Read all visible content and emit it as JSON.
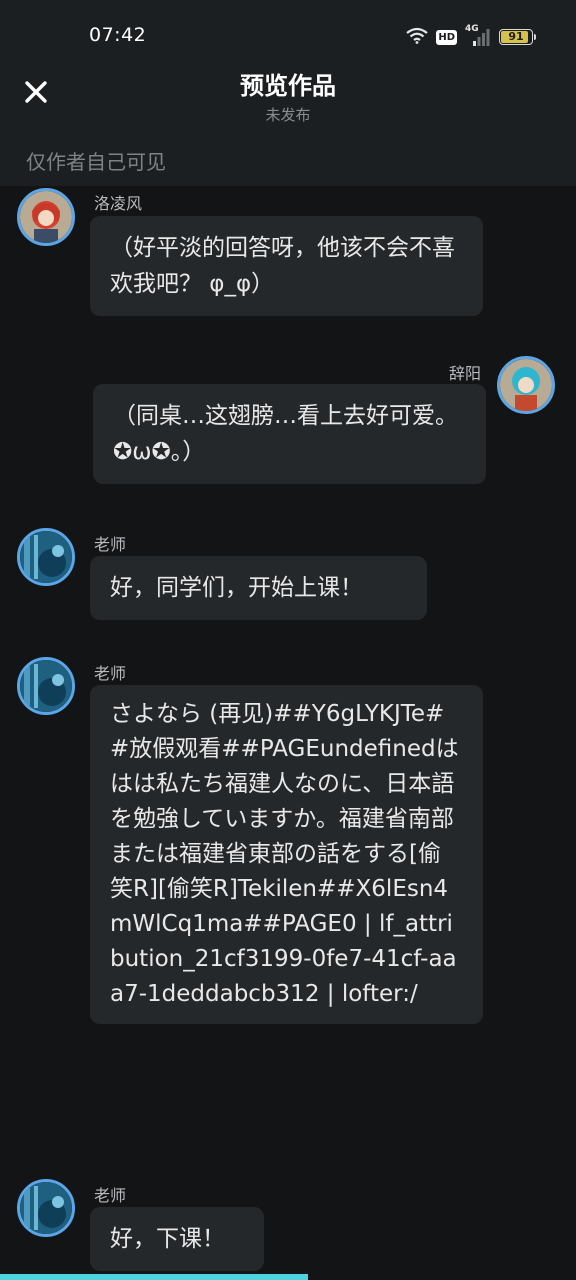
{
  "status_bar": {
    "time": "07:42",
    "hd_label": "HD",
    "network_label": "4G",
    "battery_level": "91",
    "battery_fraction": 0.91
  },
  "header": {
    "title": "预览作品",
    "subtitle": "未发布",
    "close_icon": "close-icon"
  },
  "visibility_note": "仅作者自己可见",
  "messages": [
    {
      "sender": "洛凌风",
      "side": "left",
      "text": "（好平淡的回答呀，他该不会不喜欢我吧？ φ_φ）"
    },
    {
      "sender": "辞阳",
      "side": "right",
      "text": "（同桌…这翅膀…看上去好可爱。✪ω✪。）"
    },
    {
      "sender": "老师",
      "side": "left",
      "text": "好，同学们，开始上课！"
    },
    {
      "sender": "老师",
      "side": "left",
      "text": "さよなら (再见)##Y6gLYKJTe##放假观看##PAGEundefinedははは私たち福建人なのに、日本語を勉強していますか。福建省南部または福建省東部の話をする[偷笑R][偷笑R]Tekilen##X6lEsn4mWlCq1ma##PAGE0 | lf_attribution_21cf3199-0fe7-41cf-aaa7-1deddabcb312 | lofter:/"
    },
    {
      "sender": "老师",
      "side": "left",
      "text": "好，下课！"
    }
  ],
  "progress": {
    "fraction": 0.535,
    "color": "#4ed2e0"
  },
  "colors": {
    "background": "#121416",
    "header_background": "#1c1f22",
    "bubble": "#25282b",
    "avatar_ring": "#5aa6e6"
  }
}
